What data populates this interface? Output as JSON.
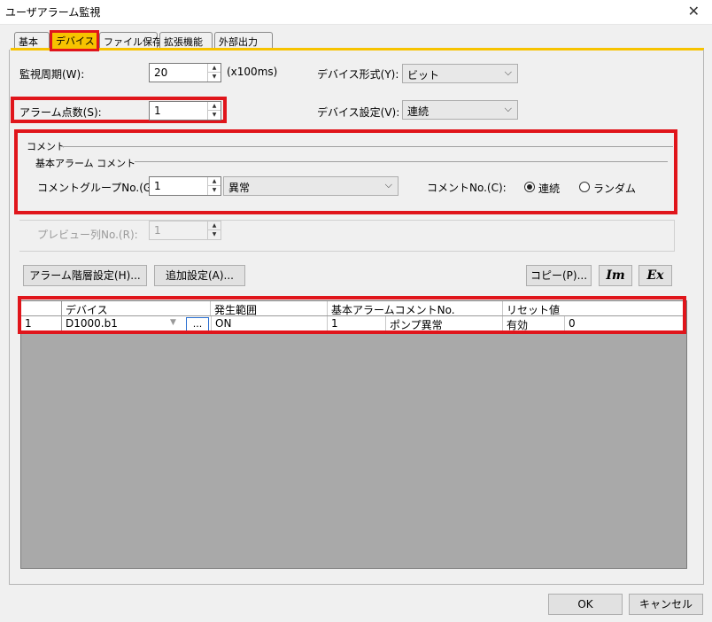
{
  "window": {
    "title": "ユーザアラーム監視",
    "close_glyph": "✕"
  },
  "tabs": [
    {
      "label": "基本",
      "active": false
    },
    {
      "label": "デバイス",
      "active": true
    },
    {
      "label": "ファイル保存",
      "active": false
    },
    {
      "label": "拡張機能",
      "active": false
    },
    {
      "label": "外部出力",
      "active": false
    }
  ],
  "monitor": {
    "label": "監視周期(W):",
    "value": "20",
    "unit": "(x100ms)"
  },
  "device_format": {
    "label": "デバイス形式(Y):",
    "value": "ビット"
  },
  "alarm_count": {
    "label": "アラーム点数(S):",
    "value": "1"
  },
  "device_setting": {
    "label": "デバイス設定(V):",
    "value": "連続"
  },
  "comment": {
    "group_title": "コメント",
    "subgroup_title": "基本アラーム コメント",
    "group_no_label": "コメントグループNo.(G):",
    "group_no_value": "1",
    "group_name_value": "異常",
    "comment_no_label": "コメントNo.(C):",
    "radio_continuous": "連続",
    "radio_random": "ランダム",
    "selected": "連続"
  },
  "preview": {
    "label": "プレビュー列No.(R):",
    "value": "1"
  },
  "buttons": {
    "alarm_level": "アラーム階層設定(H)...",
    "add_setting": "追加設定(A)...",
    "copy": "コピー(P)...",
    "im_icon": "Im",
    "ex_icon": "Ex",
    "ok": "OK",
    "cancel": "キャンセル"
  },
  "table": {
    "columns": [
      "デバイス",
      "発生範囲",
      "基本アラームコメントNo.",
      "リセット値"
    ],
    "rows": [
      {
        "num": "1",
        "device": "D1000.b1",
        "ellipsis": "...",
        "range": "ON",
        "comment_no": "1",
        "comment_text": "ポンプ異常",
        "reset": "有効",
        "reset_val": "0"
      }
    ]
  },
  "colors": {
    "accent_tab": "#f7c300",
    "highlight_box": "#e0151b"
  }
}
